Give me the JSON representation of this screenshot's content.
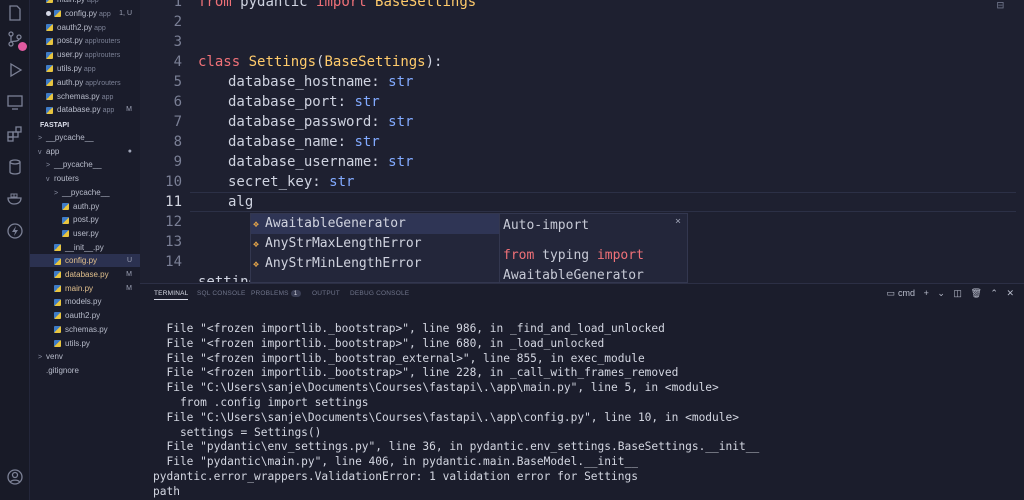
{
  "explorer": {
    "top_files": [
      {
        "name": "main.py",
        "path": "app",
        "status": "",
        "dot": false,
        "sel": false
      },
      {
        "name": "config.py",
        "path": "app",
        "status": "1, U",
        "dot": true,
        "sel": false
      },
      {
        "name": "oauth2.py",
        "path": "app",
        "status": "",
        "dot": false,
        "sel": false
      },
      {
        "name": "post.py",
        "path": "app\\routers",
        "status": "",
        "dot": false,
        "sel": false
      },
      {
        "name": "user.py",
        "path": "app\\routers",
        "status": "",
        "dot": false,
        "sel": false
      },
      {
        "name": "utils.py",
        "path": "app",
        "status": "",
        "dot": false,
        "sel": false
      },
      {
        "name": "auth.py",
        "path": "app\\routers",
        "status": "",
        "dot": false,
        "sel": false
      },
      {
        "name": "schemas.py",
        "path": "app",
        "status": "",
        "dot": false,
        "sel": false
      },
      {
        "name": "database.py",
        "path": "app",
        "status": "M",
        "dot": false,
        "sel": false
      }
    ],
    "section": "FASTAPI",
    "tree": [
      {
        "label": "__pycache__",
        "chev": ">",
        "status": "",
        "py": false
      },
      {
        "label": "app",
        "chev": "v",
        "status": "●",
        "py": false
      },
      {
        "label": "__pycache__",
        "chev": ">",
        "status": "",
        "py": false
      },
      {
        "label": "routers",
        "chev": "v",
        "status": "",
        "py": false
      },
      {
        "label": "__pycache__",
        "chev": ">",
        "status": "",
        "py": false
      },
      {
        "label": "auth.py",
        "chev": "",
        "status": "",
        "py": true
      },
      {
        "label": "post.py",
        "chev": "",
        "status": "",
        "py": true
      },
      {
        "label": "user.py",
        "chev": "",
        "status": "",
        "py": true
      },
      {
        "label": "__init__.py",
        "chev": "",
        "status": "",
        "py": true
      },
      {
        "label": "config.py",
        "chev": "",
        "status": "U",
        "py": true
      },
      {
        "label": "database.py",
        "chev": "",
        "status": "M",
        "py": true
      },
      {
        "label": "main.py",
        "chev": "",
        "status": "M",
        "py": true
      },
      {
        "label": "models.py",
        "chev": "",
        "status": "",
        "py": true
      },
      {
        "label": "oauth2.py",
        "chev": "",
        "status": "",
        "py": true
      },
      {
        "label": "schemas.py",
        "chev": "",
        "status": "",
        "py": true
      },
      {
        "label": "utils.py",
        "chev": "",
        "status": "",
        "py": true
      },
      {
        "label": "venv",
        "chev": ">",
        "status": "",
        "py": false
      },
      {
        "label": ".gitignore",
        "chev": "",
        "status": "",
        "py": false
      }
    ]
  },
  "editor": {
    "line_numbers": [
      "1",
      "2",
      "3",
      "4",
      "5",
      "6",
      "7",
      "8",
      "9",
      "10",
      "11",
      "12",
      "13",
      "14"
    ],
    "line1": {
      "kw1": "from",
      "mod": "pydantic",
      "kw2": "import",
      "name": "BaseSettings"
    },
    "line4": {
      "kw": "class",
      "cls": "Settings",
      "open": "(",
      "base": "BaseSettings",
      "close": "):"
    },
    "fields": [
      {
        "name": "database_hostname",
        "type": "str"
      },
      {
        "name": "database_port",
        "type": "str"
      },
      {
        "name": "database_password",
        "type": "str"
      },
      {
        "name": "database_name",
        "type": "str"
      },
      {
        "name": "database_username",
        "type": "str"
      },
      {
        "name": "secret_key",
        "type": "str"
      }
    ],
    "typing_line": "alg",
    "line14": "settings = Settings()"
  },
  "autocomplete": {
    "items": [
      "AwaitableGenerator",
      "AnyStrMaxLengthError",
      "AnyStrMinLengthError"
    ],
    "detail_header": "Auto-import",
    "detail_kw1": "from",
    "detail_mod": "typing",
    "detail_kw2": "import",
    "detail_name": "AwaitableGenerator",
    "close": "×"
  },
  "panel": {
    "tabs": [
      "TERMINAL",
      "SQL CONSOLE",
      "PROBLEMS",
      "OUTPUT",
      "DEBUG CONSOLE"
    ],
    "problems_count": "1",
    "shell": "cmd",
    "terminal_lines": [
      "  File \"<frozen importlib._bootstrap>\", line 986, in _find_and_load_unlocked",
      "  File \"<frozen importlib._bootstrap>\", line 680, in _load_unlocked",
      "  File \"<frozen importlib._bootstrap_external>\", line 855, in exec_module",
      "  File \"<frozen importlib._bootstrap>\", line 228, in _call_with_frames_removed",
      "  File \"C:\\Users\\sanje\\Documents\\Courses\\fastapi\\.\\app\\main.py\", line 5, in <module>",
      "    from .config import settings",
      "  File \"C:\\Users\\sanje\\Documents\\Courses\\fastapi\\.\\app\\config.py\", line 10, in <module>",
      "    settings = Settings()",
      "  File \"pydantic\\env_settings.py\", line 36, in pydantic.env_settings.BaseSettings.__init__",
      "  File \"pydantic\\main.py\", line 406, in pydantic.main.BaseModel.__init__",
      "pydantic.error_wrappers.ValidationError: 1 validation error for Settings",
      "path"
    ]
  },
  "colors": {
    "background": "#1e2030",
    "keyword": "#f07178",
    "class": "#ffcb6b",
    "type": "#82aaff"
  }
}
